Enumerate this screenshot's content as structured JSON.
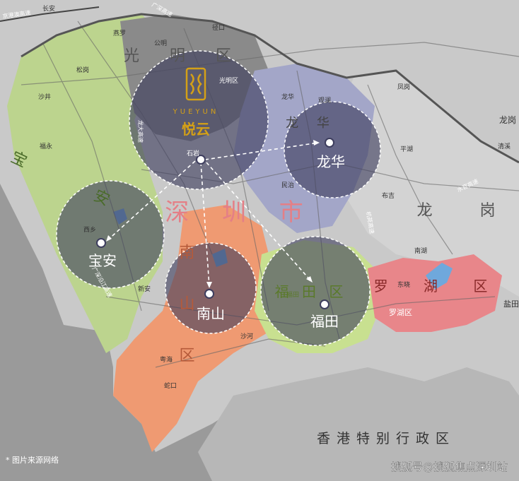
{
  "brand": {
    "logo_glyph": "ꟸ",
    "english_name": "YUEYUN",
    "chinese_name": "悦云",
    "color": "#d4a017"
  },
  "city_label": "深 圳 市",
  "hongkong_label": "香港特别行政区",
  "districts": {
    "guangming": "光 明 区",
    "baoan": "宝 安",
    "nanshan": "南 山 区",
    "futian": "福 田 区",
    "luohu": "罗 湖 区",
    "longgang": "龙 岗",
    "longhua": "龙 华"
  },
  "hubs": {
    "yueyun_circle": "悦云",
    "longhua": "龙华",
    "baoan": "宝安",
    "nanshan": "南山",
    "futian": "福田"
  },
  "place_labels": {
    "shiyan": "石岩",
    "guangming_district": "光明区",
    "gongming": "公明",
    "shajing": "沙井",
    "songgang": "松岗",
    "fuyong": "福永",
    "xixiang": "西乡",
    "xinan": "新安",
    "shekou": "蛇口",
    "yuehai": "粤海",
    "shahe": "沙河",
    "minzhi": "民治",
    "guanlan": "观澜",
    "fengang": "凤岗",
    "pinghu": "平湖",
    "buji": "布吉",
    "luohu_district": "罗湖区",
    "longgang_district": "龙岗",
    "yantian": "盐田",
    "qingxi": "清溪",
    "changan": "长安",
    "yanluo": "燕罗",
    "shiyan_2": "石岩",
    "jingkou": "径口",
    "longhua_2": "龙华",
    "dongxiao": "东晓",
    "nanhu": "南湖",
    "futian_2": "福田"
  },
  "road_labels": {
    "jinggang_ao": "京港澳高速",
    "shuiguan": "水官高速",
    "jihe": "机荷高速",
    "longda": "龙大高速",
    "guangshen": "广深沿江高速",
    "guangshen_2": "广深高速"
  },
  "footnote": "* 图片来源网络",
  "watermark": "搜狐号@搜狐焦点深圳站",
  "colors": {
    "baoan": "#bcd48e",
    "guangming": "#8a8a8a",
    "longhua": "#a3a6c8",
    "nanshan": "#ef9a72",
    "futian": "#c8e090",
    "luohu": "#e8868a",
    "longgang": "#d3d3d3",
    "outside": "#c9c9c9",
    "sea": "#9a9a9a",
    "hub_fill": "#3d3d5e",
    "city_label": "#e47f86"
  }
}
